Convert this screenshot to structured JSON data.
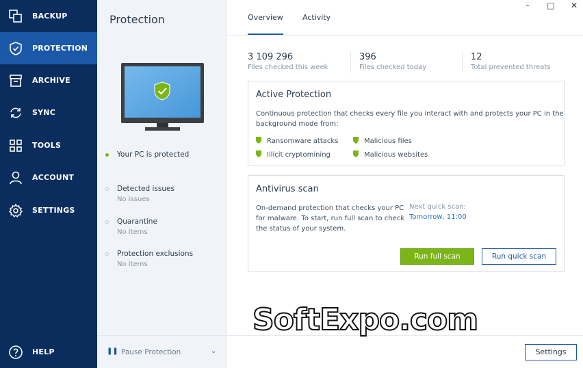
{
  "sidebar": {
    "items": [
      {
        "label": "BACKUP",
        "icon": "backup-icon"
      },
      {
        "label": "PROTECTION",
        "icon": "shield-icon",
        "active": true
      },
      {
        "label": "ARCHIVE",
        "icon": "archive-icon"
      },
      {
        "label": "SYNC",
        "icon": "sync-icon"
      },
      {
        "label": "TOOLS",
        "icon": "tools-icon"
      },
      {
        "label": "ACCOUNT",
        "icon": "account-icon"
      },
      {
        "label": "SETTINGS",
        "icon": "settings-icon"
      }
    ],
    "help": {
      "label": "HELP",
      "icon": "help-icon"
    }
  },
  "panel": {
    "title": "Protection",
    "status_main": "Your PC is protected",
    "items": [
      {
        "title": "Detected issues",
        "subtitle": "No issues"
      },
      {
        "title": "Quarantine",
        "subtitle": "No items"
      },
      {
        "title": "Protection exclusions",
        "subtitle": "No items"
      }
    ],
    "pause_label": "Pause Protection"
  },
  "tabs": [
    {
      "label": "Overview",
      "active": true
    },
    {
      "label": "Activity"
    }
  ],
  "stats": [
    {
      "number": "3 109 296",
      "label": "Files checked this week"
    },
    {
      "number": "396",
      "label": "Files checked today"
    },
    {
      "number": "12",
      "label": "Total prevented threats"
    }
  ],
  "active_protection": {
    "title": "Active Protection",
    "description_line1": "Continuous protection that checks every file you interact with and protects your PC in the",
    "description_line2": "background mode from:",
    "features": [
      "Ransomware attacks",
      "Illicit cryptomining",
      "Malicious files",
      "Malicious websites"
    ]
  },
  "antivirus": {
    "title": "Antivirus scan",
    "description_line1": "On-demand protection that checks your PC",
    "description_line2": "for malware. To start, run full scan to check",
    "description_line3": "the status of your system.",
    "next_scan_label": "Next quick scan:",
    "next_scan_value": "Tomorrow, 11:00",
    "full_scan_label": "Run full scan",
    "quick_scan_label": "Run quick scan"
  },
  "footer": {
    "settings_label": "Settings"
  },
  "watermark": "SoftExpo.com",
  "colors": {
    "sidebar_bg": "#0b2d5e",
    "sidebar_active": "#1c58a8",
    "accent": "#1c58a8",
    "green": "#7cb518"
  }
}
